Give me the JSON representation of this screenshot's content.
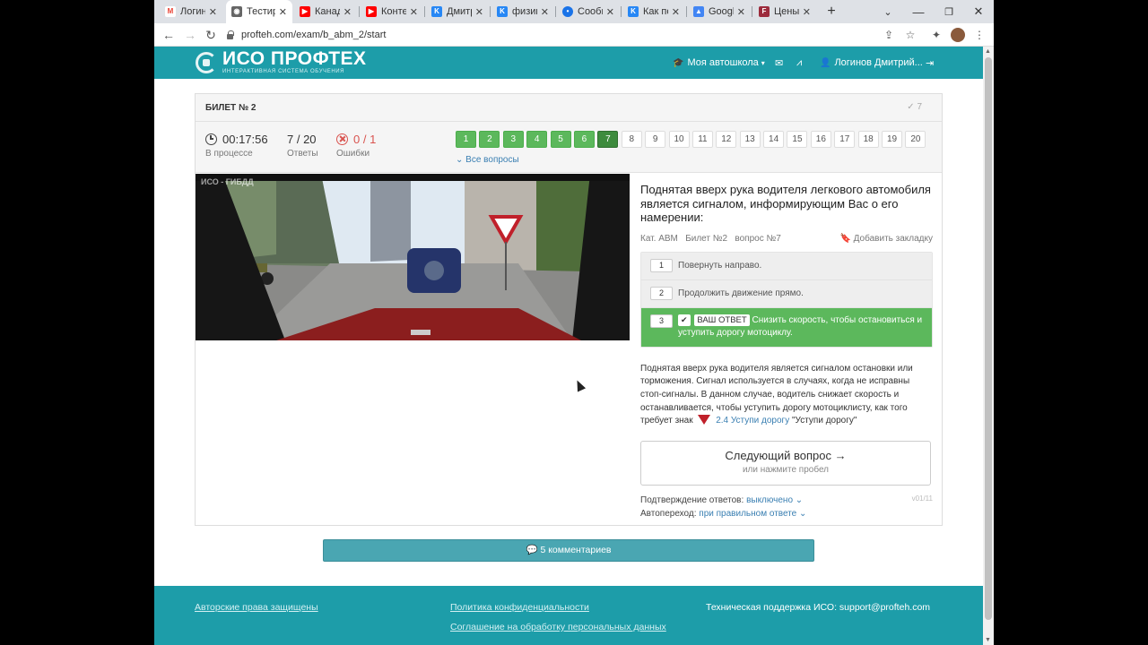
{
  "browser": {
    "tabs": [
      {
        "label": "Логин",
        "icon": "gmail-icon",
        "color": "#ea4335"
      },
      {
        "label": "Тестир",
        "icon": "profteh-icon",
        "color": "#555555",
        "active": true
      },
      {
        "label": "Канада",
        "icon": "youtube-icon",
        "color": "#ff0000"
      },
      {
        "label": "Конте",
        "icon": "youtube-icon",
        "color": "#ff0000"
      },
      {
        "label": "Дмитр",
        "icon": "vk-icon",
        "color": "#2787f5"
      },
      {
        "label": "физик",
        "icon": "vk-icon",
        "color": "#2787f5"
      },
      {
        "label": "Сообщ",
        "icon": "messenger-icon",
        "color": "#1a73e8"
      },
      {
        "label": "Как по",
        "icon": "vk-icon",
        "color": "#2787f5"
      },
      {
        "label": "Google",
        "icon": "google-scholar-icon",
        "color": "#4285f4"
      },
      {
        "label": "Цены",
        "icon": "site-icon",
        "color": "#9c2b3c"
      }
    ],
    "new_tab": "+",
    "url": "profteh.com/exam/b_abm_2/start"
  },
  "site": {
    "logo_name": "ИСО ПРОФТЕХ",
    "logo_tagline": "ИНТЕРАКТИВНАЯ СИСТЕМА ОБУЧЕНИЯ",
    "nav_school": "Моя автошкола",
    "nav_user": "Логинов Дмитрий..."
  },
  "ticket": {
    "title": "БИЛЕТ № 2",
    "check_count": "✓ 7",
    "timer": "00:17:56",
    "timer_label": "В процессе",
    "answers": "7 / 20",
    "answers_label": "Ответы",
    "errors": "0 / 1",
    "errors_label": "Ошибки",
    "question_numbers": [
      "1",
      "2",
      "3",
      "4",
      "5",
      "6",
      "7",
      "8",
      "9",
      "10",
      "11",
      "12",
      "13",
      "14",
      "15",
      "16",
      "17",
      "18",
      "19",
      "20"
    ],
    "answered_count": 6,
    "current": 7,
    "all_questions": "Все вопросы"
  },
  "scene": {
    "watermark": "ИСО - ГИБДД"
  },
  "question": {
    "text": "Поднятая вверх рука водителя легкового автомобиля является сигналом, информирующим Вас о его намерении:",
    "meta": "Кат. АВМ   Билет №2   вопрос №7",
    "bookmark": "Добавить закладку",
    "options": [
      {
        "num": "1",
        "text": "Повернуть направо."
      },
      {
        "num": "2",
        "text": "Продолжить движение прямо."
      },
      {
        "num": "3",
        "text": "Снизить скорость, чтобы остановиться и уступить дорогу мотоциклу."
      }
    ],
    "your_answer_label": "ВАШ ОТВЕТ",
    "explanation_before": "Поднятая вверх рука водителя является сигналом остановки или торможения. Сигнал используется в случаях, когда не исправны стоп-сигналы.  В данном случае, водитель снижает скорость и останавливается, чтобы уступить дорогу мотоциклисту, как того требует знак",
    "sign_link": "2.4 Уступи дорогу",
    "explanation_after": "\"Уступи дорогу\"",
    "next_title": "Следующий вопрос →",
    "next_hint": "или нажмите пробел",
    "confirm_label": "Подтверждение ответов:",
    "confirm_value": "выключено",
    "auto_label": "Автопереход:",
    "auto_value": "при правильном ответе",
    "version": "v01/11"
  },
  "comments": {
    "label": "5 комментариев"
  },
  "footer": {
    "copyright": "Авторские права защищены",
    "privacy": "Политика конфиденциальности",
    "agreement": "Соглашение на обработку персональных данных",
    "support": "Техническая поддержка ИСО:  support@profteh.com"
  }
}
